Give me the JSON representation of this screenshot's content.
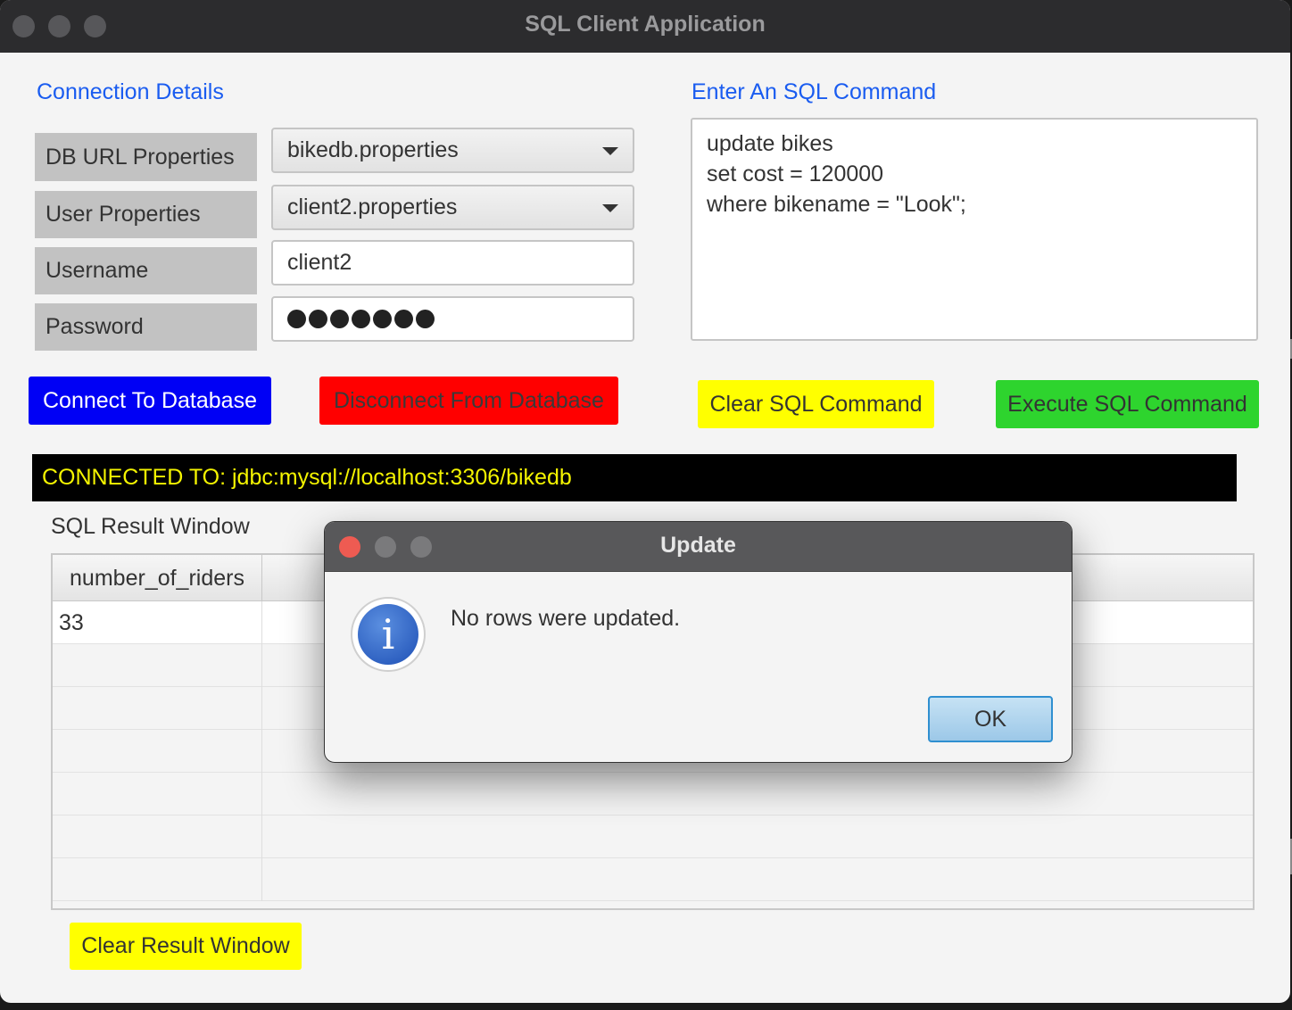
{
  "window": {
    "title": "SQL Client Application"
  },
  "connection": {
    "section_title": "Connection Details",
    "db_url_label": "DB URL Properties",
    "db_url_value": "bikedb.properties",
    "user_props_label": "User Properties",
    "user_props_value": "client2.properties",
    "username_label": "Username",
    "username_value": "client2",
    "password_label": "Password",
    "password_mask_count": 7
  },
  "sql": {
    "section_title": "Enter An SQL Command",
    "lines": [
      "update bikes",
      "set cost = 120000",
      "where bikename = \"Look\";"
    ]
  },
  "buttons": {
    "connect": "Connect To Database",
    "disconnect": "Disconnect From Database",
    "clear_sql": "Clear SQL Command",
    "execute_sql": "Execute SQL Command",
    "clear_result": "Clear Result Window"
  },
  "status": {
    "text": "CONNECTED TO: jdbc:mysql://localhost:3306/bikedb"
  },
  "results": {
    "label": "SQL Result Window",
    "columns": [
      "number_of_riders"
    ],
    "rows": [
      [
        "33"
      ]
    ]
  },
  "dialog": {
    "title": "Update",
    "message": "No rows were updated.",
    "ok_label": "OK",
    "icon": "info-icon"
  },
  "colors": {
    "accent_blue": "#1a5cf0",
    "connect_bg": "#0000f5",
    "disconnect_bg": "#ff0000",
    "clear_bg": "#ffff00",
    "execute_bg": "#2ed42e",
    "status_text": "#f4f400"
  }
}
